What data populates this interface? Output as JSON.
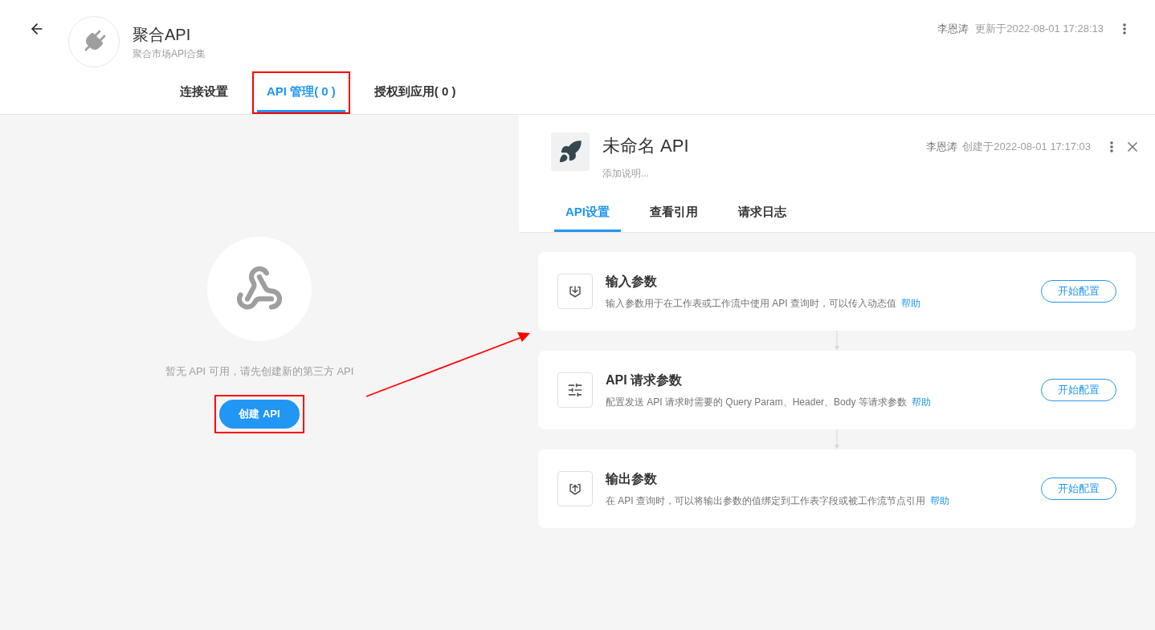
{
  "header": {
    "title": "聚合API",
    "subtitle": "聚合市场API合集",
    "author": "李恩涛",
    "updated": "更新于2022-08-01 17:28:13"
  },
  "tabs": [
    {
      "label": "连接设置",
      "selected": false
    },
    {
      "label": "API 管理( 0 )",
      "selected": true,
      "highlighted": true
    },
    {
      "label": "授权到应用( 0 )",
      "selected": false
    }
  ],
  "empty_state": {
    "message": "暂无 API 可用，请先创建新的第三方 API",
    "button": "创建 API"
  },
  "panel": {
    "title": "未命名 API",
    "description_placeholder": "添加说明...",
    "author": "李恩涛",
    "created": "创建于2022-08-01 17:17:03",
    "tabs": [
      {
        "label": "API设置",
        "selected": true
      },
      {
        "label": "查看引用",
        "selected": false
      },
      {
        "label": "请求日志",
        "selected": false
      }
    ],
    "steps": [
      {
        "kind": "input",
        "title": "输入参数",
        "description": "输入参数用于在工作表或工作流中使用 API 查询时，可以传入动态值",
        "help": "帮助",
        "button": "开始配置"
      },
      {
        "kind": "request",
        "title": "API 请求参数",
        "description": "配置发送 API 请求时需要的 Query Param、Header、Body 等请求参数",
        "help": "帮助",
        "button": "开始配置"
      },
      {
        "kind": "output",
        "title": "输出参数",
        "description": "在 API 查询时，可以将输出参数的值绑定到工作表字段或被工作流节点引用",
        "help": "帮助",
        "button": "开始配置"
      }
    ]
  }
}
